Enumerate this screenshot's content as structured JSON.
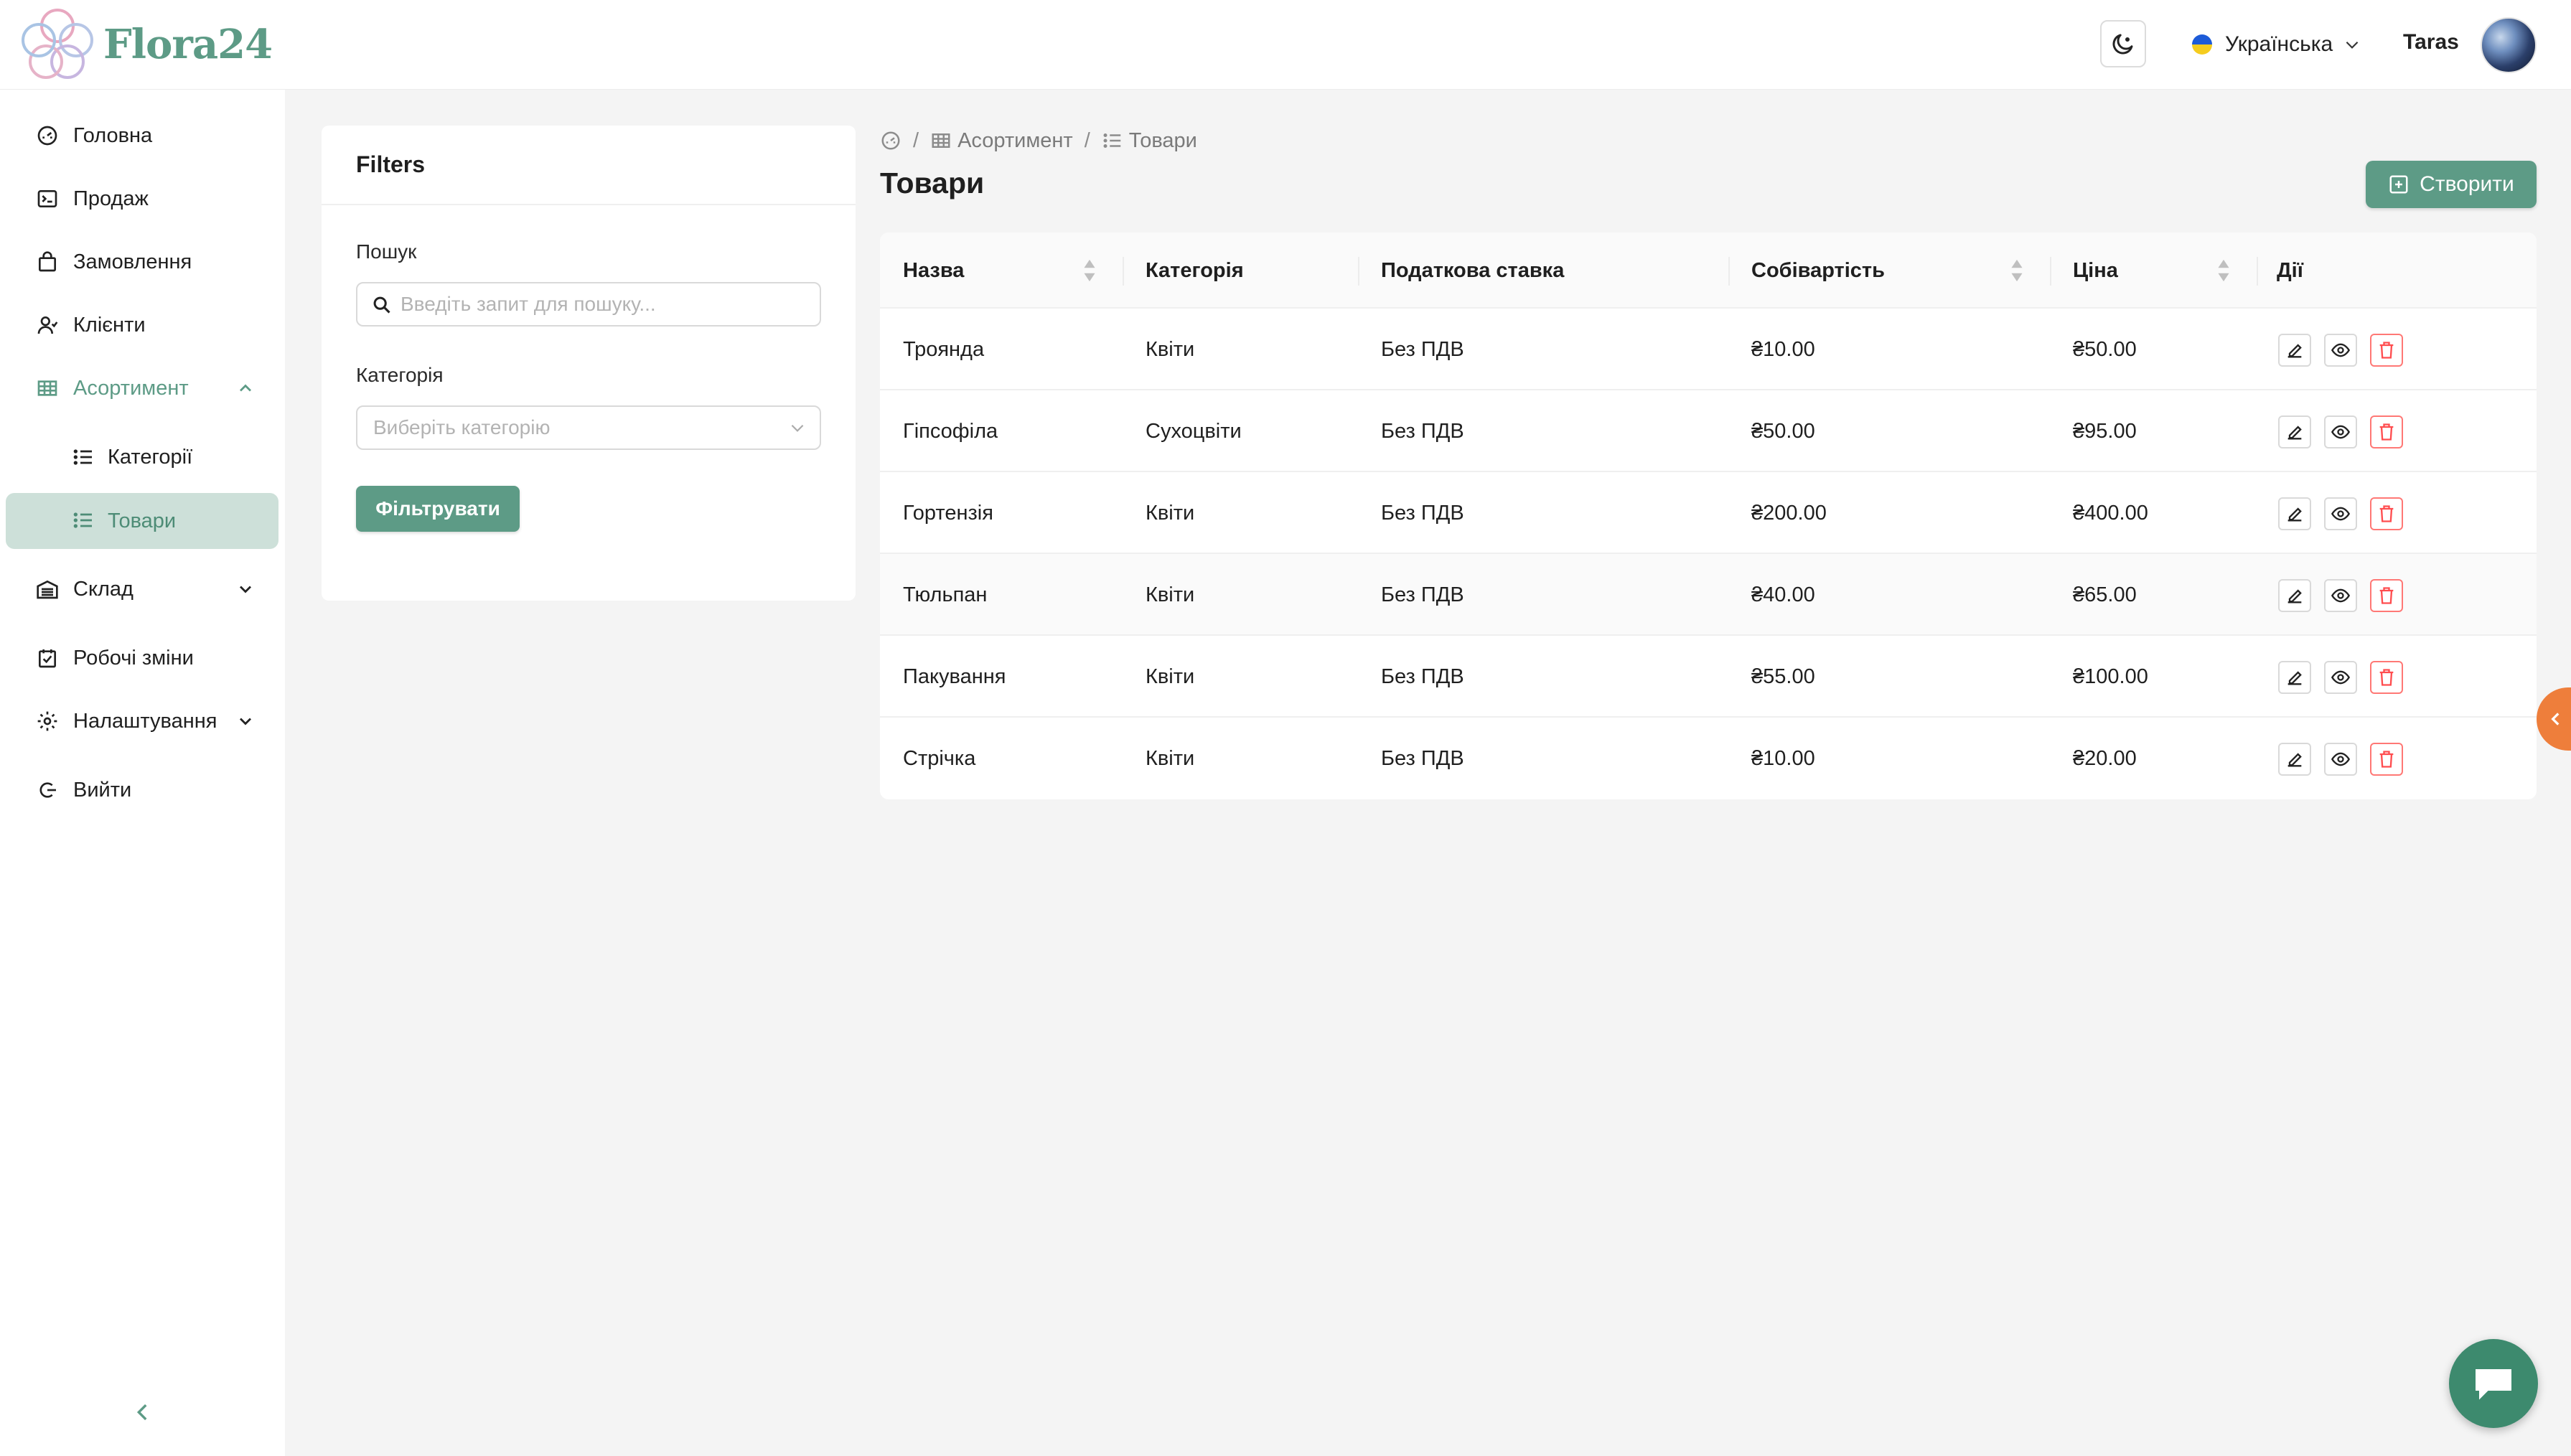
{
  "app": {
    "name": "Flora24"
  },
  "header": {
    "language": "Українська",
    "user_name": "Taras",
    "icons": [
      "moon-icon",
      "ukraine-flag-icon",
      "chevron-down-icon"
    ]
  },
  "sidebar": {
    "items": [
      {
        "label": "Головна",
        "icon": "dashboard-icon"
      },
      {
        "label": "Продаж",
        "icon": "terminal-icon"
      },
      {
        "label": "Замовлення",
        "icon": "shopping-bag-icon"
      },
      {
        "label": "Клієнти",
        "icon": "users-icon"
      },
      {
        "label": "Асортимент",
        "icon": "table-icon",
        "expanded": true
      },
      {
        "label": "Категорії",
        "icon": "list-icon"
      },
      {
        "label": "Товари",
        "icon": "list-icon",
        "active": true
      },
      {
        "label": "Склад",
        "icon": "warehouse-icon"
      },
      {
        "label": "Робочі зміни",
        "icon": "calendar-check-icon"
      },
      {
        "label": "Налаштування",
        "icon": "gear-icon"
      },
      {
        "label": "Вийти",
        "icon": "logout-icon"
      }
    ]
  },
  "filters": {
    "title": "Filters",
    "search_label": "Пошук",
    "search_placeholder": "Введіть запит для пошуку...",
    "category_label": "Категорія",
    "category_placeholder": "Виберіть категорію",
    "submit_label": "Фільтрувати"
  },
  "breadcrumb": {
    "items": [
      "Асортимент",
      "Товари"
    ],
    "separator": "/"
  },
  "page": {
    "title": "Товари",
    "create_label": "Створити"
  },
  "table": {
    "columns": [
      "Назва",
      "Категорія",
      "Податкова ставка",
      "Собівартість",
      "Ціна",
      "Дії"
    ],
    "rows": [
      {
        "name": "Троянда",
        "category": "Квіти",
        "tax": "Без ПДВ",
        "cost": "₴10.00",
        "price": "₴50.00"
      },
      {
        "name": "Гіпсофіла",
        "category": "Сухоцвіти",
        "tax": "Без ПДВ",
        "cost": "₴50.00",
        "price": "₴95.00"
      },
      {
        "name": "Гортензія",
        "category": "Квіти",
        "tax": "Без ПДВ",
        "cost": "₴200.00",
        "price": "₴400.00"
      },
      {
        "name": "Тюльпан",
        "category": "Квіти",
        "tax": "Без ПДВ",
        "cost": "₴40.00",
        "price": "₴65.00"
      },
      {
        "name": "Пакування",
        "category": "Квіти",
        "tax": "Без ПДВ",
        "cost": "₴55.00",
        "price": "₴100.00"
      },
      {
        "name": "Стрічка",
        "category": "Квіти",
        "tax": "Без ПДВ",
        "cost": "₴10.00",
        "price": "₴20.00"
      }
    ]
  },
  "colors": {
    "brand": "#5d9b86",
    "active_bg": "#cde0d9",
    "danger": "#ff4d4f",
    "side_tab": "#ee7e3b",
    "chat": "#3d8a6e"
  }
}
